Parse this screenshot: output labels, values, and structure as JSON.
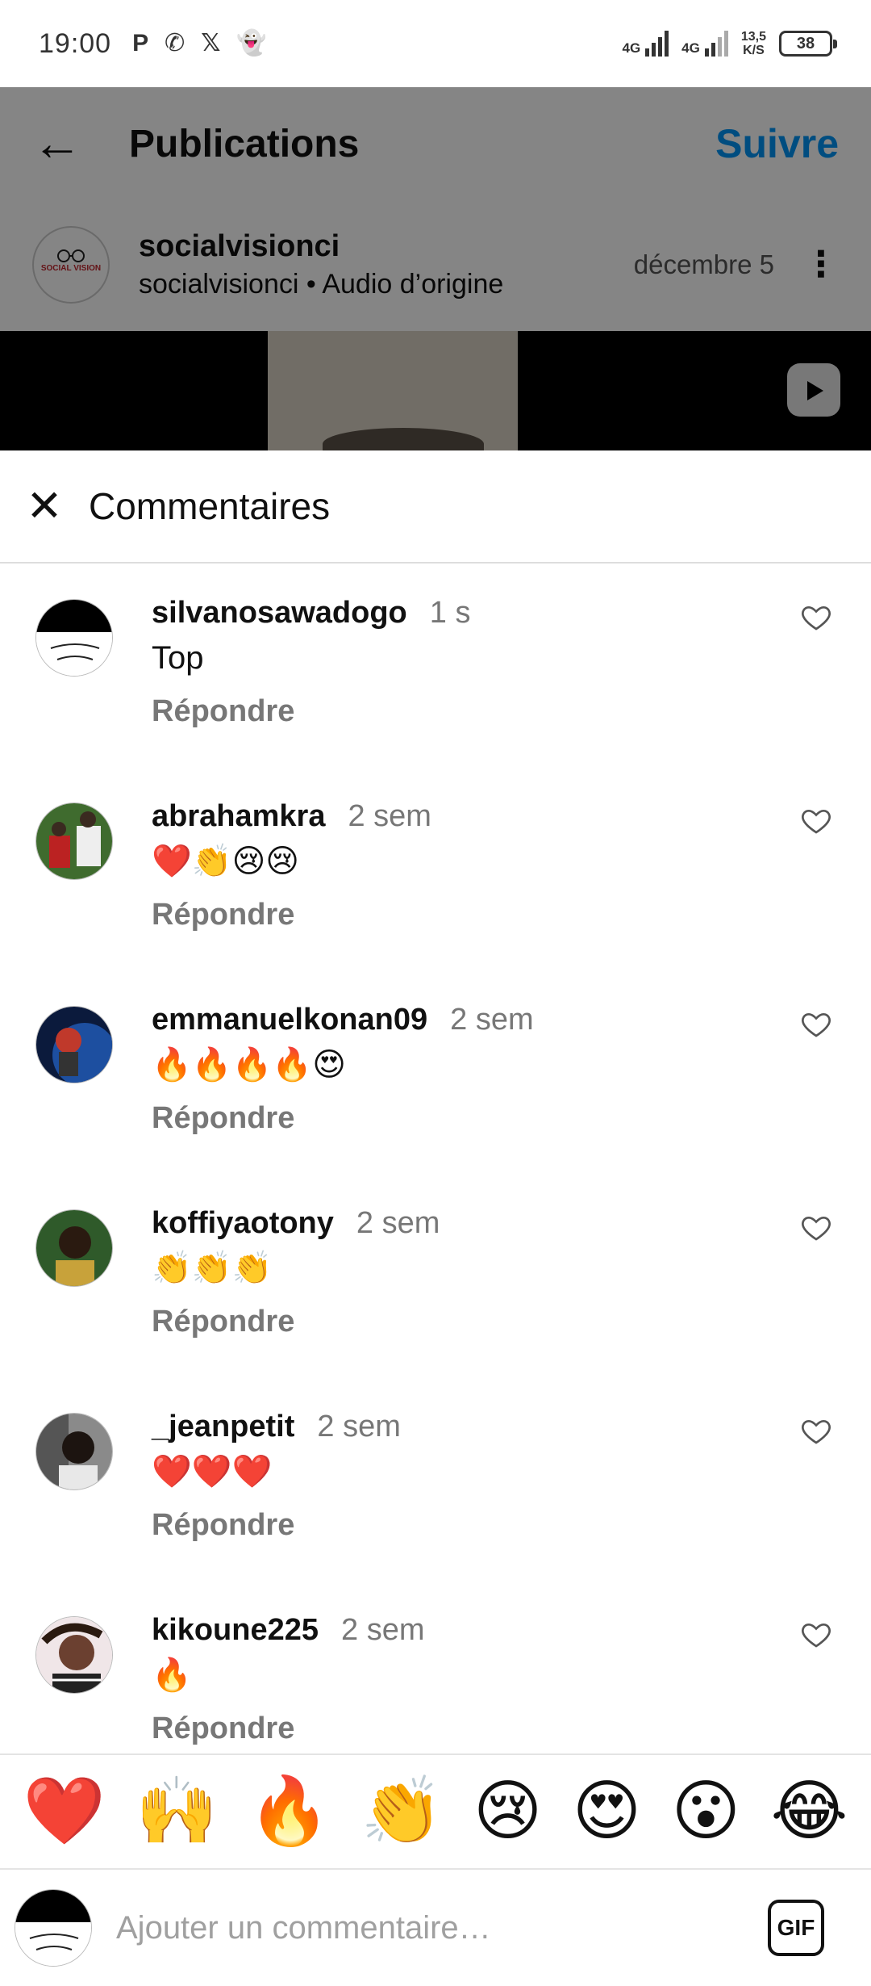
{
  "status_bar": {
    "time": "19:00",
    "app_icons": [
      "P",
      "✆",
      "𝕏",
      "👻"
    ],
    "network1": "4G",
    "network2": "4G",
    "speed_value": "13,5",
    "speed_unit": "K/S",
    "battery": "38"
  },
  "post": {
    "back_icon": "←",
    "title": "Publications",
    "follow_label": "Suivre",
    "author_name": "socialvisionci",
    "author_sub": "socialvisionci • Audio d’origine",
    "date": "décembre 5",
    "more_icon": "⋮",
    "avatar_logo_text": "SOCIAL VISION"
  },
  "sheet": {
    "close_icon": "✕",
    "title": "Commentaires"
  },
  "comments": [
    {
      "username": "silvanosawadogo",
      "time": "1 s",
      "text": "Top",
      "reply": "Répondre"
    },
    {
      "username": "abrahamkra",
      "time": "2 sem",
      "text": "❤️👏😢😢",
      "reply": "Répondre"
    },
    {
      "username": "emmanuelkonan09",
      "time": "2 sem",
      "text": "🔥🔥🔥🔥😍",
      "reply": "Répondre"
    },
    {
      "username": "koffiyaotony",
      "time": "2 sem",
      "text": "👏👏👏",
      "reply": "Répondre"
    },
    {
      "username": "_jeanpetit",
      "time": "2 sem",
      "text": "❤️❤️❤️",
      "reply": "Répondre"
    },
    {
      "username": "kikoune225",
      "time": "2 sem",
      "text": "🔥",
      "reply": "Répondre"
    }
  ],
  "emoji_bar": [
    "❤️",
    "🙌",
    "🔥",
    "👏",
    "😢",
    "😍",
    "😮",
    "😂"
  ],
  "input": {
    "placeholder": "Ajouter un commentaire…",
    "gif_label": "GIF"
  },
  "colors": {
    "accent": "#0095f6",
    "muted": "#777777"
  }
}
